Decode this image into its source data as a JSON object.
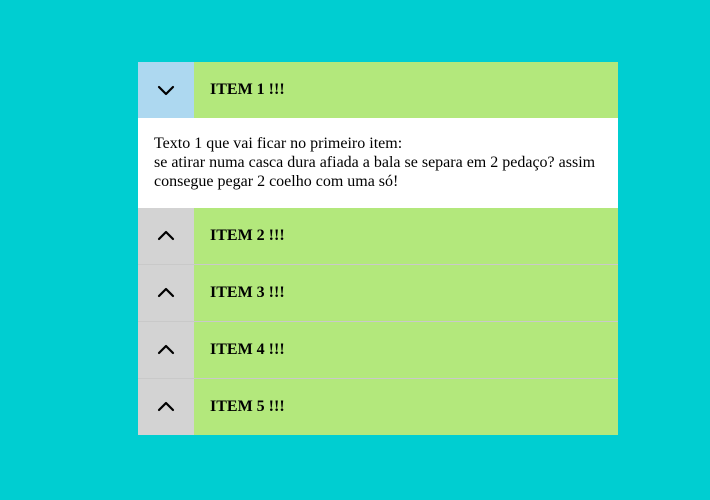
{
  "accordion": {
    "items": [
      {
        "title": "ITEM 1 !!!",
        "state": "expanded",
        "toggle_icon": "chevron-down-icon",
        "content_line1": "Texto 1 que vai ficar no primeiro item:",
        "content_line2": "se atirar numa casca dura afiada a bala se separa em 2 pedaço? assim consegue pegar 2 coelho com uma só!"
      },
      {
        "title": "ITEM 2 !!!",
        "state": "collapsed",
        "toggle_icon": "chevron-up-icon"
      },
      {
        "title": "ITEM 3 !!!",
        "state": "collapsed",
        "toggle_icon": "chevron-up-icon"
      },
      {
        "title": "ITEM 4 !!!",
        "state": "collapsed",
        "toggle_icon": "chevron-up-icon"
      },
      {
        "title": "ITEM 5 !!!",
        "state": "collapsed",
        "toggle_icon": "chevron-up-icon"
      }
    ]
  },
  "colors": {
    "page_background": "#00ced1",
    "header_background": "#b3e87c",
    "toggle_open_background": "#add8f0",
    "toggle_closed_background": "#d3d3d3",
    "content_background": "#ffffff"
  }
}
